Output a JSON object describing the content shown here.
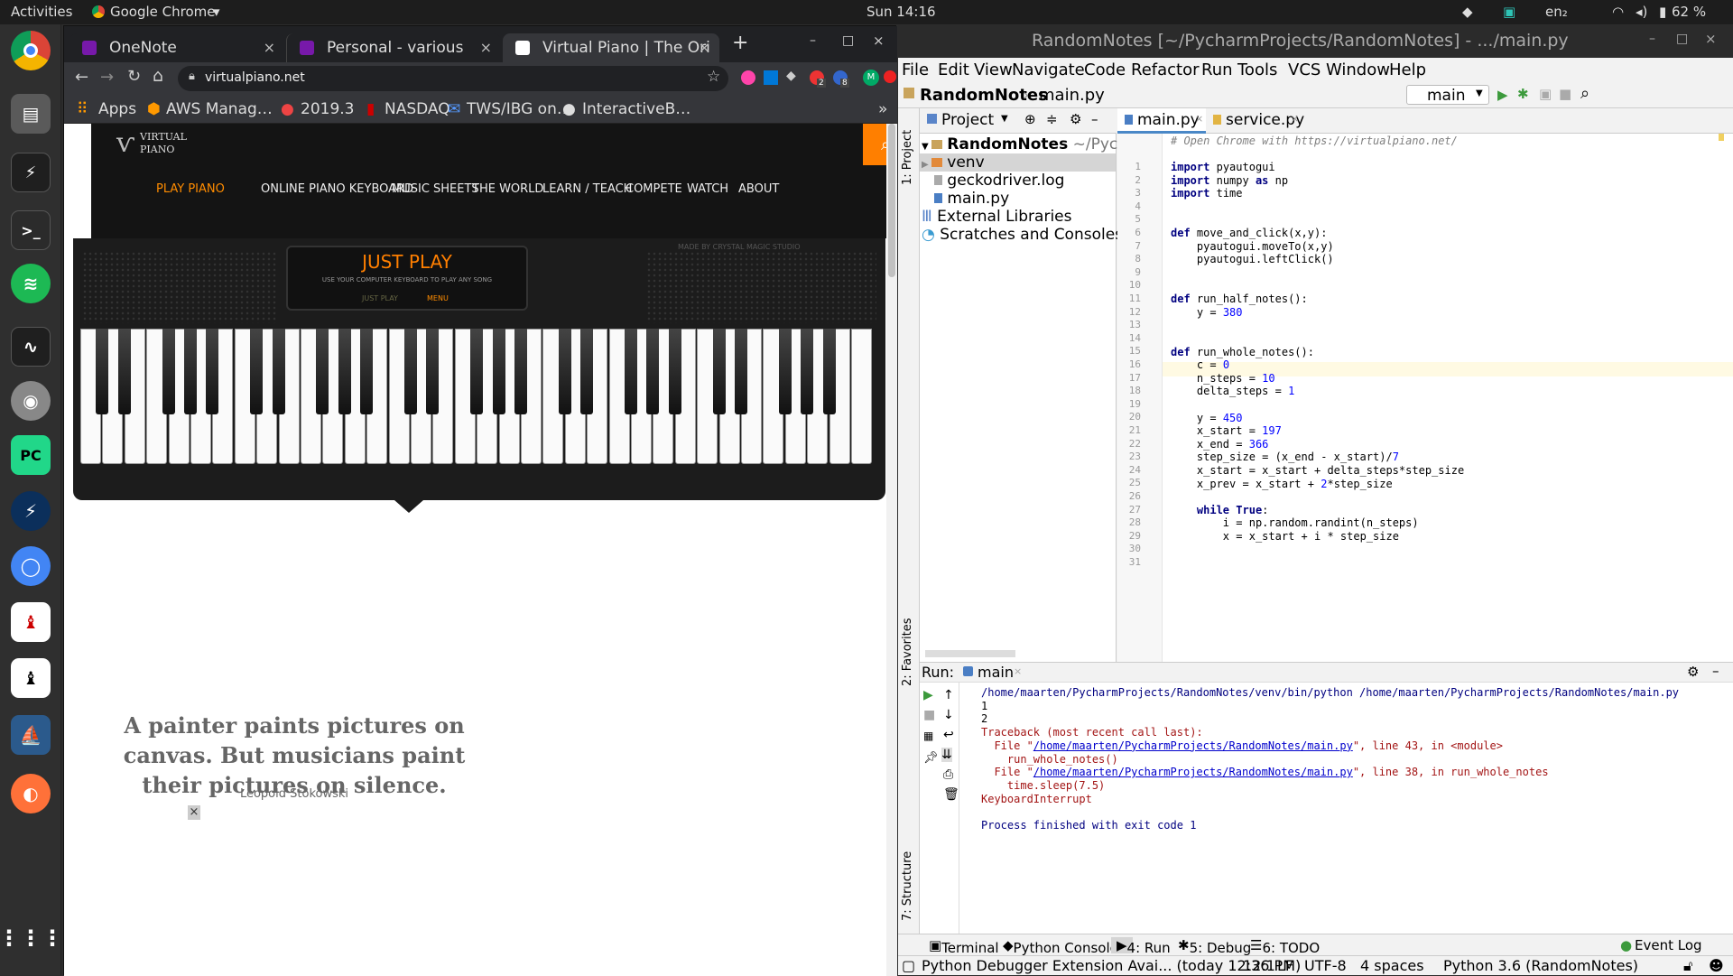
{
  "topbar": {
    "activities": "Activities",
    "app": "Google Chrome",
    "app_caret": "▾",
    "clock": "Sun 14:16",
    "lang": "en₂",
    "battery": "62 %"
  },
  "dock": {
    "apps": [
      "Chrome",
      "Files",
      "System Monitor",
      "Terminal",
      "Spotify",
      "System Monitor 2",
      "Disk",
      "PyCharm",
      "Charm",
      "Chromium",
      "Trader",
      "Trader 2",
      "MySQL Workbench",
      "Firefox",
      "Show Applications"
    ]
  },
  "chrome": {
    "tabs": [
      {
        "label": "OneNote",
        "close": "×"
      },
      {
        "label": "Personal - various",
        "close": "×"
      },
      {
        "label": "Virtual Piano | The Ori",
        "close": "×"
      }
    ],
    "new_tab": "+",
    "window_controls": {
      "min": "–",
      "max": "□",
      "close": "×"
    },
    "url": "virtualpiano.net",
    "ext_badges": [
      "2",
      "8"
    ],
    "bookmarks": [
      {
        "label": "Apps"
      },
      {
        "label": "AWS Manag…"
      },
      {
        "label": "2019.3"
      },
      {
        "label": "NASDAQ"
      },
      {
        "label": "TWS/IBG on…"
      },
      {
        "label": "InteractiveB…"
      }
    ],
    "bm_more": "»"
  },
  "site": {
    "logo_top": "VIRTUAL",
    "logo_bottom": "PIANO",
    "nav": [
      "PLAY PIANO",
      "ONLINE PIANO KEYBOARD",
      "MUSIC SHEETS",
      "THE WORLD",
      "LEARN / TEACH",
      "COMPETE",
      "WATCH",
      "ABOUT"
    ],
    "made_by": "MADE BY CRYSTAL MAGIC STUDIO",
    "panel_title": "JUST PLAY",
    "panel_sub": "USE YOUR COMPUTER KEYBOARD TO PLAY ANY SONG",
    "panel_btn1": "JUST PLAY",
    "panel_btn2": "MENU",
    "quote": "A painter paints pictures on canvas. But musicians paint their pictures on silence.",
    "author": "Leopold Stokowski",
    "close_x": "×"
  },
  "pycharm": {
    "title": "RandomNotes [~/PycharmProjects/RandomNotes] - .../main.py",
    "window_controls": {
      "min": "–",
      "max": "□",
      "close": "×"
    },
    "menu": [
      "File",
      "Edit",
      "View",
      "Navigate",
      "Code",
      "Refactor",
      "Run",
      "Tools",
      "VCS",
      "Window",
      "Help"
    ],
    "breadcrumb": [
      "RandomNotes",
      "main.py"
    ],
    "run_config": "main",
    "project_tab": "Project",
    "project_tree": [
      {
        "label": "RandomNotes",
        "suffix": "~/Pycharm"
      },
      {
        "label": "venv"
      },
      {
        "label": "geckodriver.log"
      },
      {
        "label": "main.py"
      },
      {
        "label": "External Libraries"
      },
      {
        "label": "Scratches and Consoles"
      }
    ],
    "editor_tabs": [
      "main.py",
      "service.py"
    ],
    "code": [
      "# Open Chrome with https://virtualpiano.net/",
      "",
      "import pyautogui",
      "import numpy as np",
      "import time",
      "",
      "",
      "def move_and_click(x,y):",
      "    pyautogui.moveTo(x,y)",
      "    pyautogui.leftClick()",
      "",
      "",
      "def run_half_notes():",
      "    y = 380",
      "",
      "",
      "def run_whole_notes():",
      "    c = 0",
      "    n_steps = 10",
      "    delta_steps = 1",
      "",
      "    y = 450",
      "    x_start = 197",
      "    x_end = 366",
      "    step_size = (x_end - x_start)/7",
      "    x_start = x_start + delta_steps*step_size",
      "    x_prev = x_start + 2*step_size",
      "",
      "    while True:",
      "        i = np.random.randint(n_steps)",
      "        x = x_start + i * step_size"
    ],
    "run_label": "Run:",
    "run_tab": "main",
    "run_output": [
      "/home/maarten/PycharmProjects/RandomNotes/venv/bin/python /home/maarten/PycharmProjects/RandomNotes/main.py",
      "1",
      "2",
      "Traceback (most recent call last):",
      "  File \"/home/maarten/PycharmProjects/RandomNotes/main.py\", line 43, in <module>",
      "    run_whole_notes()",
      "  File \"/home/maarten/PycharmProjects/RandomNotes/main.py\", line 38, in run_whole_notes",
      "    time.sleep(7.5)",
      "KeyboardInterrupt",
      "",
      "Process finished with exit code 1"
    ],
    "side_tabs": [
      "1: Project",
      "2: Favorites",
      "7: Structure"
    ],
    "bottom_tabs": [
      "Terminal",
      "Python Console",
      "4: Run",
      "5: Debug",
      "6: TODO"
    ],
    "event_log": "Event Log",
    "status": {
      "message": "Python Debugger Extension Avai... (today 12:36 PM)",
      "pos": "12:1",
      "eol": "LF",
      "enc": "UTF-8",
      "indent": "4 spaces",
      "interp": "Python 3.6 (RandomNotes)"
    }
  },
  "colors": {
    "accent_orange": "#ff7f00",
    "py_keyword": "#000080",
    "py_number": "#0000ff",
    "error_red": "#a31515"
  }
}
